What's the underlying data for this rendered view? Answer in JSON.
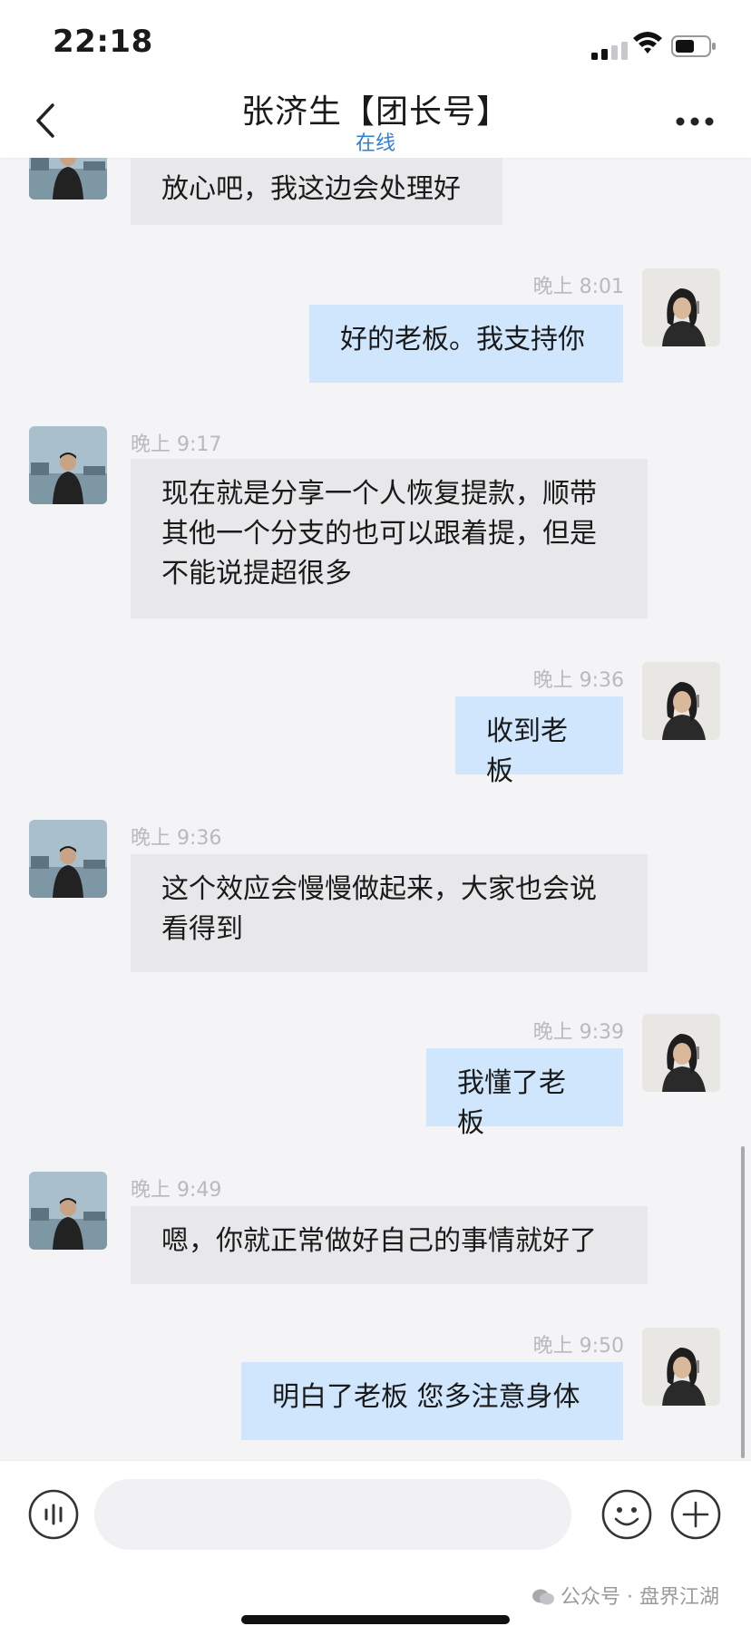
{
  "status_bar": {
    "time": "22:18"
  },
  "header": {
    "title": "张济生【团长号】",
    "status": "在线"
  },
  "messages": [
    {
      "side": "in",
      "time": "",
      "text": "放心吧，我这边会处理好"
    },
    {
      "side": "out",
      "time": "晚上 8:01",
      "text": "好的老板。我支持你"
    },
    {
      "side": "in",
      "time": "晚上 9:17",
      "text": "现在就是分享一个人恢复提款，顺带\n其他一个分支的也可以跟着提，但是\n不能说提超很多"
    },
    {
      "side": "out",
      "time": "晚上 9:36",
      "text": "收到老板"
    },
    {
      "side": "in",
      "time": "晚上 9:36",
      "text": "这个效应会慢慢做起来，大家也会说\n看得到"
    },
    {
      "side": "out",
      "time": "晚上 9:39",
      "text": "我懂了老板"
    },
    {
      "side": "in",
      "time": "晚上 9:49",
      "text": "嗯，你就正常做好自己的事情就好了"
    },
    {
      "side": "out",
      "time": "晚上 9:50",
      "text": "明白了老板 您多注意身体"
    }
  ],
  "input": {
    "placeholder": ""
  },
  "watermark": "公众号 · 盘界江湖",
  "colors": {
    "accent": "#2f7fd8",
    "incoming_bubble": "#e8e8ea",
    "outgoing_bubble": "#cfe6fd",
    "background": "#f4f4f6"
  }
}
